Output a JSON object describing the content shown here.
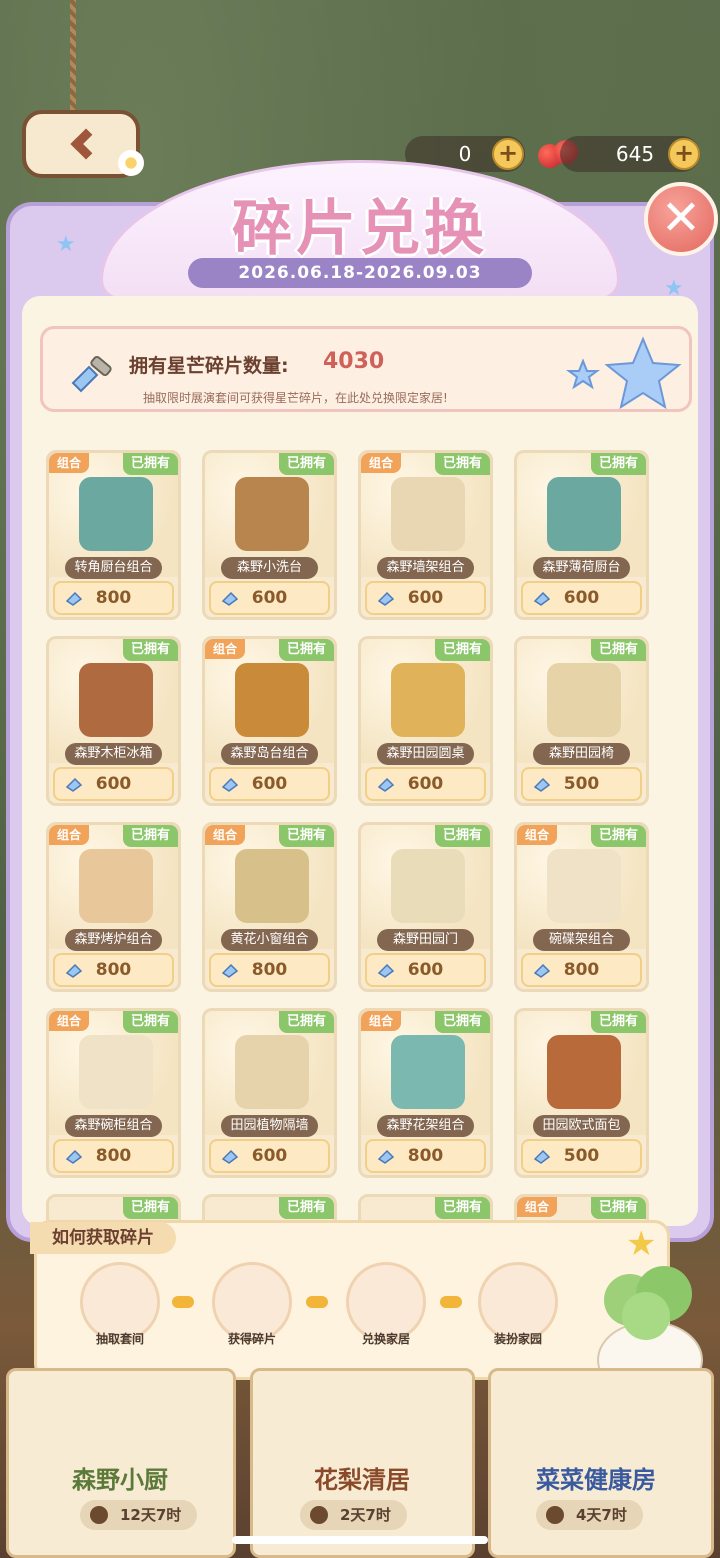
{
  "header": {
    "title": "碎片兑换",
    "date_range": "2026.06.18-2026.09.03"
  },
  "currencies": [
    {
      "name": "token",
      "value": "0"
    },
    {
      "name": "cherry",
      "value": "645"
    }
  ],
  "info": {
    "label": "拥有星芒碎片数量:",
    "count": "4030",
    "tip": "抽取限时展演套间可获得星芒碎片，在此处兑换限定家居!"
  },
  "tags": {
    "combo": "组合",
    "owned": "已拥有"
  },
  "items": [
    {
      "name": "转角厨台组合",
      "price": "800",
      "combo": true,
      "owned": true,
      "color": "#6aa8a0"
    },
    {
      "name": "森野小洗台",
      "price": "600",
      "combo": false,
      "owned": true,
      "color": "#b9854f"
    },
    {
      "name": "森野墙架组合",
      "price": "600",
      "combo": true,
      "owned": true,
      "color": "#e9d6b2"
    },
    {
      "name": "森野薄荷厨台",
      "price": "600",
      "combo": false,
      "owned": true,
      "color": "#6aa8a0"
    },
    {
      "name": "森野木柜冰箱",
      "price": "600",
      "combo": false,
      "owned": true,
      "color": "#b06a40"
    },
    {
      "name": "森野岛台组合",
      "price": "600",
      "combo": true,
      "owned": true,
      "color": "#c98a3a"
    },
    {
      "name": "森野田园圆桌",
      "price": "600",
      "combo": false,
      "owned": true,
      "color": "#e0b25a"
    },
    {
      "name": "森野田园椅",
      "price": "500",
      "combo": false,
      "owned": true,
      "color": "#e7d3a8"
    },
    {
      "name": "森野烤炉组合",
      "price": "800",
      "combo": true,
      "owned": true,
      "color": "#e8c79a"
    },
    {
      "name": "黄花小窗组合",
      "price": "800",
      "combo": true,
      "owned": true,
      "color": "#d8c08a"
    },
    {
      "name": "森野田园门",
      "price": "600",
      "combo": false,
      "owned": true,
      "color": "#e9dcb8"
    },
    {
      "name": "碗碟架组合",
      "price": "800",
      "combo": true,
      "owned": true,
      "color": "#f0e2c6"
    },
    {
      "name": "森野碗柜组合",
      "price": "800",
      "combo": true,
      "owned": true,
      "color": "#f0e2c6"
    },
    {
      "name": "田园植物隔墙",
      "price": "600",
      "combo": false,
      "owned": true,
      "color": "#e6d3ac"
    },
    {
      "name": "森野花架组合",
      "price": "800",
      "combo": true,
      "owned": true,
      "color": "#7ab8b0"
    },
    {
      "name": "田园欧式面包",
      "price": "500",
      "combo": false,
      "owned": true,
      "color": "#b96a3a"
    }
  ],
  "how_to": {
    "title": "如何获取碎片",
    "steps": [
      "抽取套间",
      "获得碎片",
      "兑换家居",
      "装扮家园"
    ]
  },
  "shops": [
    {
      "name": "森野小厨",
      "time": "12天7时",
      "color": "#5b7a3a"
    },
    {
      "name": "花梨清居",
      "time": "2天7时",
      "color": "#8a4a2a"
    },
    {
      "name": "菜菜健康房",
      "time": "4天7时",
      "color": "#3a5aa0"
    }
  ]
}
